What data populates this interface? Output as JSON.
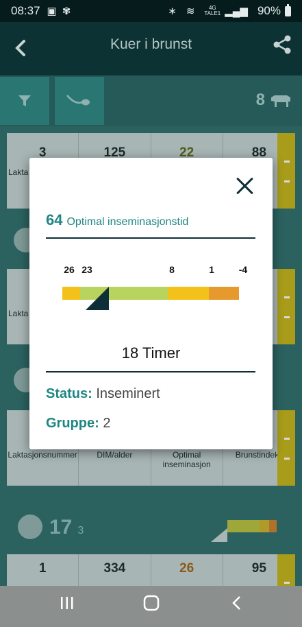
{
  "status_bar": {
    "time": "08:37",
    "network_top": "4G",
    "network_bottom": "TALE1",
    "battery": "90%"
  },
  "app_bar": {
    "title": "Kuer i brunst"
  },
  "filter_bar": {
    "count": "8"
  },
  "background_list": {
    "card1": {
      "v1": "3",
      "v2": "125",
      "v3": "22",
      "v4": "88",
      "l1": "Lakta"
    },
    "card2": {
      "l1": "Lakta"
    },
    "card3": {
      "l1": "Laktasjonsnummer",
      "l2": "DIM/alder",
      "l3": "Optimal inseminasjon",
      "l4": "Brunstindeks"
    },
    "group": {
      "number": "17",
      "count": "3"
    },
    "card4": {
      "v1": "1",
      "v2": "334",
      "v3": "26",
      "v4": "95"
    }
  },
  "dialog": {
    "value": "64",
    "label": "Optimal inseminasjonstid",
    "ticks": [
      {
        "label": "26"
      },
      {
        "label": "23"
      },
      {
        "label": "8"
      },
      {
        "label": "1"
      },
      {
        "label": "-4"
      }
    ],
    "timer": "18 Timer",
    "status_label": "Status:",
    "status_value": "Inseminert",
    "group_label": "Gruppe:",
    "group_value": "2",
    "colors": {
      "accent": "#1f8683",
      "dark": "#0e2f38",
      "yellow": "#f2c21b",
      "green": "#b8d35e",
      "orange": "#e69a2d"
    }
  },
  "nav": {
    "recent_icon": "recent-apps-icon",
    "home_icon": "home-icon",
    "back_icon": "back-icon"
  }
}
